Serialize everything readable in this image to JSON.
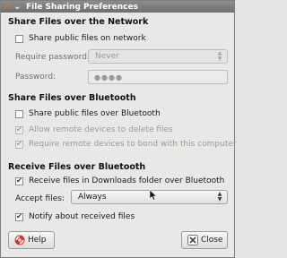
{
  "window": {
    "title": "File Sharing Preferences"
  },
  "network": {
    "heading": "Share Files over the Network",
    "share_public": {
      "label": "Share public files on network",
      "checked": false
    },
    "require_password": {
      "label": "Require password:",
      "value": "Never"
    },
    "password": {
      "label": "Password:",
      "value": "●●●●"
    }
  },
  "bluetooth_share": {
    "heading": "Share Files over Bluetooth",
    "share_public": {
      "label": "Share public files over Bluetooth",
      "checked": false
    },
    "allow_delete": {
      "label": "Allow remote devices to delete files",
      "checked": true
    },
    "require_bond": {
      "label": "Require remote devices to bond with this computer",
      "checked": true
    }
  },
  "bluetooth_receive": {
    "heading": "Receive Files over Bluetooth",
    "receive_downloads": {
      "label": "Receive files in Downloads folder over Bluetooth",
      "checked": true
    },
    "accept_files": {
      "label": "Accept files:",
      "value": "Always"
    },
    "notify": {
      "label": "Notify about received files",
      "checked": true
    }
  },
  "buttons": {
    "help": "Help",
    "close": "Close"
  },
  "colors": {
    "titlebar": "#7e7e7c",
    "close_icon": "#f06a2b",
    "help_icon": "#d2332a",
    "close_btn_icon": "#444444"
  },
  "icons": {
    "window_menu": "chevron-down-icon",
    "window_close": "close-icon",
    "help": "lifebuoy-icon",
    "close": "close-x-icon"
  }
}
